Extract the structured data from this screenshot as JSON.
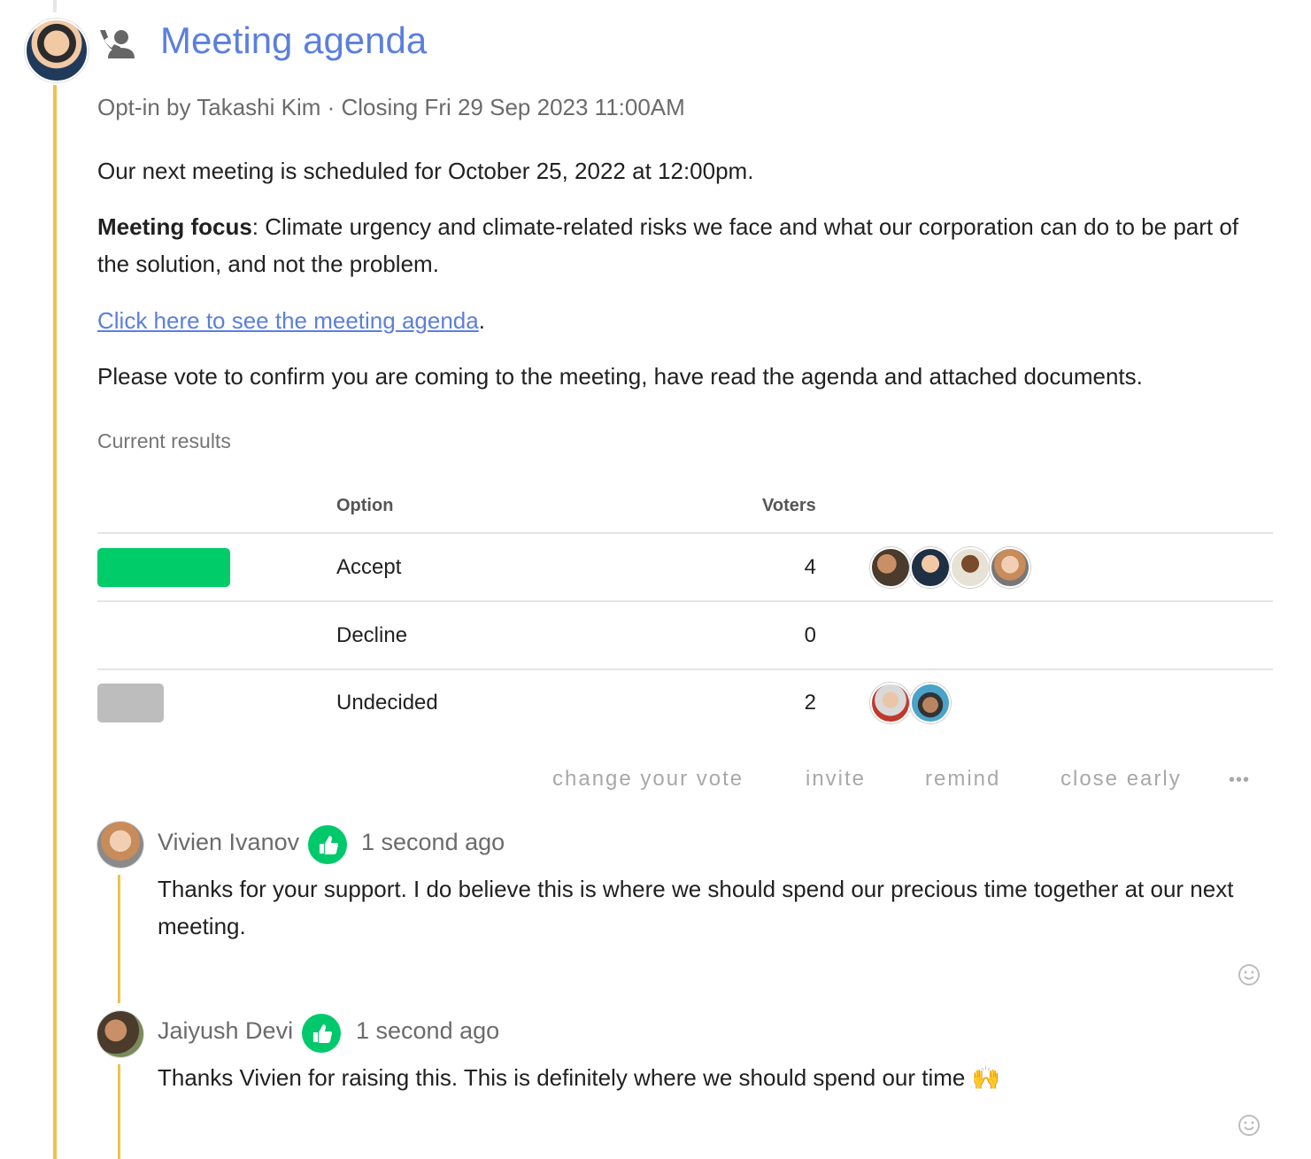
{
  "poll": {
    "title": "Meeting agenda",
    "meta": "Opt-in by Takashi Kim · Closing Fri 29 Sep 2023 11:00AM",
    "body_line1": "Our next meeting is scheduled for October 25, 2022 at 12:00pm.",
    "focus_label": "Meeting focus",
    "focus_text": ": Climate urgency and climate-related risks we face and what our corporation can do to be part of the solution, and not the problem.",
    "agenda_link": "Click here to see the meeting agenda",
    "agenda_link_suffix": ".",
    "vote_request": "Please vote to confirm you are coming to the meeting, have read the agenda and attached documents."
  },
  "results": {
    "label": "Current results",
    "col_option": "Option",
    "col_voters": "Voters",
    "rows": [
      {
        "option": "Accept",
        "count": "4",
        "share": 0.6667,
        "color": "#00cc6a"
      },
      {
        "option": "Decline",
        "count": "0",
        "share": 0,
        "color": "#e0e0e0"
      },
      {
        "option": "Undecided",
        "count": "2",
        "share": 0.3333,
        "color": "#bdbdbd"
      }
    ]
  },
  "actions": {
    "change_vote": "change your vote",
    "invite": "invite",
    "remind": "remind",
    "close_early": "close early",
    "more": "•••"
  },
  "comments": [
    {
      "author": "Vivien Ivanov",
      "time": "1 second ago",
      "text": "Thanks for your support. I do believe this is where we should spend our precious time together at our next meeting."
    },
    {
      "author": "Jaiyush Devi",
      "time": "1 second ago",
      "text": "Thanks Vivien for raising this. This is definitely where we should spend our time 🙌"
    }
  ],
  "colors": {
    "accent": "#5b7fde",
    "timeline": "#f0c14b",
    "agree": "#00c96b"
  }
}
